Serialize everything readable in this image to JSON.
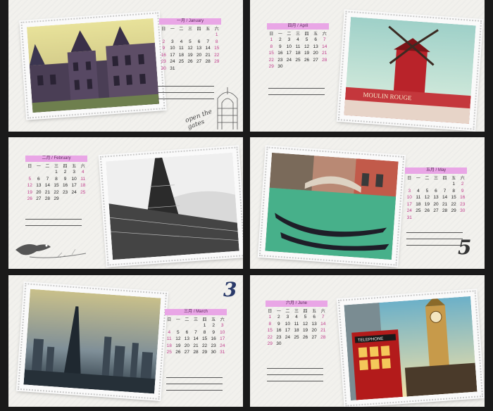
{
  "weekdays": [
    "日",
    "一",
    "二",
    "三",
    "四",
    "五",
    "六"
  ],
  "months": {
    "jan": {
      "header": "一月 / January",
      "days": [
        "",
        "",
        "",
        "",
        "",
        "",
        "1",
        "2",
        "3",
        "4",
        "5",
        "6",
        "7",
        "8",
        "9",
        "10",
        "11",
        "12",
        "13",
        "14",
        "15",
        "16",
        "17",
        "18",
        "19",
        "20",
        "21",
        "22",
        "23",
        "24",
        "25",
        "26",
        "27",
        "28",
        "29",
        "30",
        "31",
        "",
        "",
        "",
        ""
      ]
    },
    "apr": {
      "header": "四月 / April",
      "days": [
        "",
        "",
        "",
        "",
        "",
        "",
        "",
        "1",
        "2",
        "3",
        "4",
        "5",
        "6",
        "7",
        "8",
        "9",
        "10",
        "11",
        "12",
        "13",
        "14",
        "15",
        "16",
        "17",
        "18",
        "19",
        "20",
        "21",
        "22",
        "23",
        "24",
        "25",
        "26",
        "27",
        "28",
        "29",
        "30"
      ]
    },
    "feb": {
      "header": "二月 / February",
      "days": [
        "",
        "",
        "",
        "1",
        "2",
        "3",
        "4",
        "5",
        "6",
        "7",
        "8",
        "9",
        "10",
        "11",
        "12",
        "13",
        "14",
        "15",
        "16",
        "17",
        "18",
        "19",
        "20",
        "21",
        "22",
        "23",
        "24",
        "25",
        "26",
        "27",
        "28",
        "29"
      ]
    },
    "may": {
      "header": "五月 / May",
      "days": [
        "",
        "",
        "",
        "",
        "",
        "1",
        "2",
        "3",
        "4",
        "5",
        "6",
        "7",
        "8",
        "9",
        "10",
        "11",
        "12",
        "13",
        "14",
        "15",
        "16",
        "17",
        "18",
        "19",
        "20",
        "21",
        "22",
        "23",
        "24",
        "25",
        "26",
        "27",
        "28",
        "29",
        "30",
        "31"
      ]
    },
    "mar": {
      "header": "三月 / March",
      "days": [
        "",
        "",
        "",
        "",
        "1",
        "2",
        "3",
        "4",
        "5",
        "6",
        "7",
        "8",
        "9",
        "10",
        "11",
        "12",
        "13",
        "14",
        "15",
        "16",
        "17",
        "18",
        "19",
        "20",
        "21",
        "22",
        "23",
        "24",
        "25",
        "26",
        "27",
        "28",
        "29",
        "30",
        "31"
      ]
    },
    "jun": {
      "header": "六月 / June",
      "days": [
        "1",
        "2",
        "3",
        "4",
        "5",
        "6",
        "7",
        "8",
        "9",
        "10",
        "11",
        "12",
        "13",
        "14",
        "15",
        "16",
        "17",
        "18",
        "19",
        "20",
        "21",
        "22",
        "23",
        "24",
        "25",
        "26",
        "27",
        "28",
        "29",
        "30"
      ]
    }
  },
  "deco": {
    "open_gates": "open the gates",
    "num_three": "3",
    "num_five": "5",
    "telephone": "TELEPHONE",
    "moulin": "MOULIN ROUGE"
  }
}
